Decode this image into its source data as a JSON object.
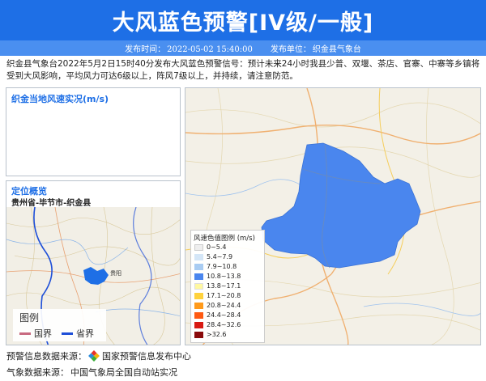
{
  "title": "大风蓝色预警[IV级/一般]",
  "meta": {
    "publish_time_label": "发布时间：",
    "publish_time": "2022-05-02 15:40:00",
    "publisher_label": "发布单位：",
    "publisher": "织金县气象台"
  },
  "description": "织金县气象台2022年5月2日15时40分发布大风蓝色预警信号：预计未来24小时我县少普、双堰、茶店、官寨、中寨等乡镇将受到大风影响，平均风力可达6级以上，阵风7级以上，并持续，请注意防范。",
  "wind_panel": {
    "title": "织金当地风速实况(m/s)"
  },
  "location_panel": {
    "title": "定位概览",
    "path": "贵州省-毕节市-织金县",
    "map_legend": {
      "title": "图例",
      "items": [
        {
          "label": "国界",
          "color": "#c86a80"
        },
        {
          "label": "省界",
          "color": "#1e4fd8"
        }
      ]
    }
  },
  "main_map": {
    "alert_area_color": "#4a86ee",
    "wind_legend": {
      "title": "风速色值图例 (m/s)",
      "items": [
        {
          "label": "0~5.4",
          "color": "#eeeeee"
        },
        {
          "label": "5.4~7.9",
          "color": "#d4e6f7"
        },
        {
          "label": "7.9~10.8",
          "color": "#a9ccf2"
        },
        {
          "label": "10.8~13.8",
          "color": "#4a86ee"
        },
        {
          "label": "13.8~17.1",
          "color": "#fff8a0"
        },
        {
          "label": "17.1~20.8",
          "color": "#ffd23c"
        },
        {
          "label": "20.8~24.4",
          "color": "#ff9a1a"
        },
        {
          "label": "24.4~28.4",
          "color": "#ff5a12"
        },
        {
          "label": "28.4~32.6",
          "color": "#d81a12"
        },
        {
          "label": ">32.6",
          "color": "#8a0a0a"
        }
      ]
    }
  },
  "footer": {
    "source1_label": "预警信息数据来源：",
    "source1_icon": "national-warning-logo-icon",
    "source1_value": "国家预警信息发布中心",
    "source2_label": "气象数据来源：",
    "source2_value": "中国气象局全国自动站实况"
  }
}
